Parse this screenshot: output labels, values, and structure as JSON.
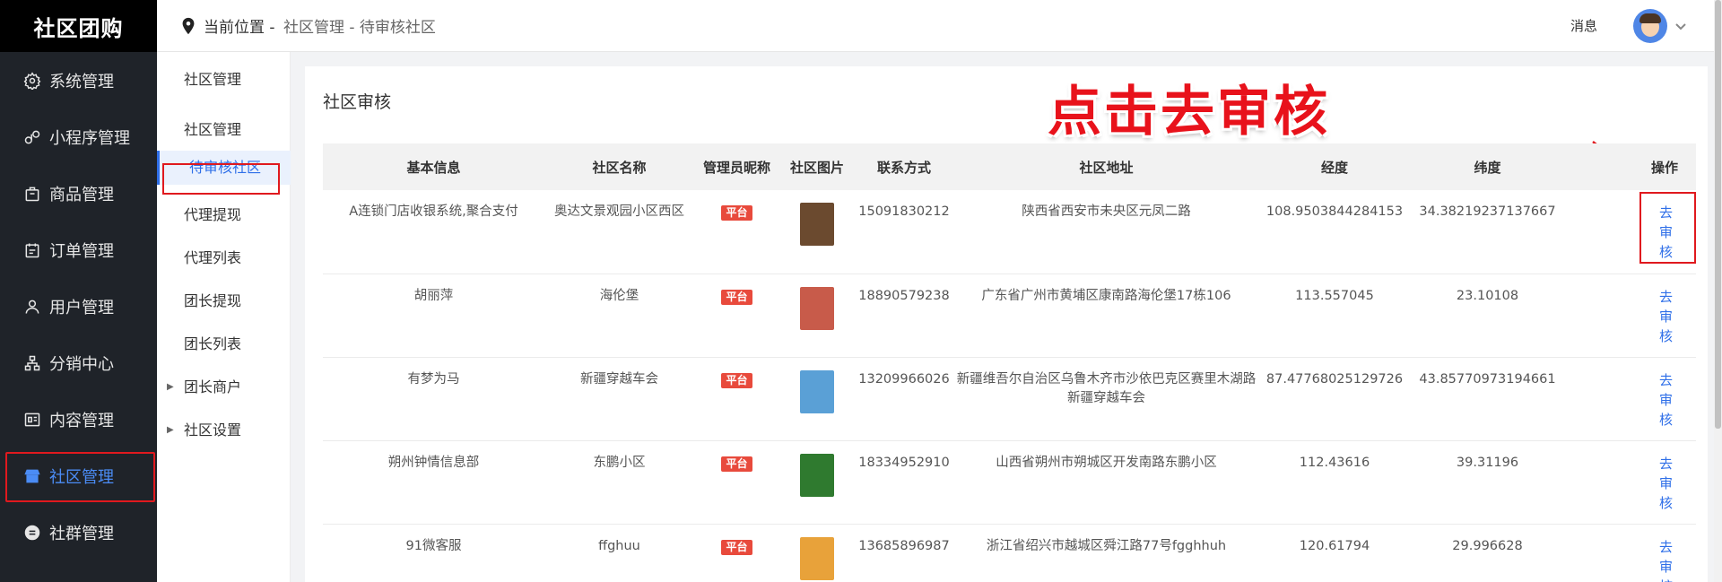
{
  "brand": "社区团购",
  "menu": [
    {
      "label": "系统管理",
      "icon": "gear-icon"
    },
    {
      "label": "小程序管理",
      "icon": "miniprogram-icon"
    },
    {
      "label": "商品管理",
      "icon": "bag-icon"
    },
    {
      "label": "订单管理",
      "icon": "calendar-icon"
    },
    {
      "label": "用户管理",
      "icon": "user-icon"
    },
    {
      "label": "分销中心",
      "icon": "org-icon"
    },
    {
      "label": "内容管理",
      "icon": "content-icon"
    },
    {
      "label": "社区管理",
      "icon": "store-icon"
    },
    {
      "label": "社群管理",
      "icon": "group-icon"
    }
  ],
  "topbar": {
    "crumb_prefix": "当前位置 - ",
    "crumb_rest": "社区管理 - 待审核社区",
    "message": "消息"
  },
  "submenu": {
    "header": "社区管理",
    "items": [
      "社区管理",
      "待审核社区",
      "代理提现",
      "代理列表",
      "团长提现",
      "团长列表",
      "团长商户",
      "社区设置"
    ]
  },
  "content": {
    "title": "社区审核",
    "overlay": "点击去审核"
  },
  "table": {
    "headers": [
      "基本信息",
      "社区名称",
      "管理员昵称",
      "社区图片",
      "联系方式",
      "社区地址",
      "经度",
      "纬度",
      "操作"
    ],
    "rows": [
      {
        "info": "A连锁门店收银系统,聚合支付",
        "name": "奥达文景观园小区西区",
        "admin": "平台",
        "phone": "15091830212",
        "address": "陕西省西安市未央区元凤二路",
        "lng": "108.9503844284153",
        "lat": "34.38219237137667",
        "op": "去审核",
        "img": "#6b4a2f"
      },
      {
        "info": "胡丽萍",
        "name": "海伦堡",
        "admin": "平台",
        "phone": "18890579238",
        "address": "广东省广州市黄埔区康南路海伦堡17栋106",
        "lng": "113.557045",
        "lat": "23.10108",
        "op": "去审核",
        "img": "#c85b4a"
      },
      {
        "info": "有梦为马",
        "name": "新疆穿越车会",
        "admin": "平台",
        "phone": "13209966026",
        "address": "新疆维吾尔自治区乌鲁木齐市沙依巴克区赛里木湖路新疆穿越车会",
        "lng": "87.47768025129726",
        "lat": "43.85770973194661",
        "op": "去审核",
        "img": "#5aa0d6"
      },
      {
        "info": "朔州钟情信息部",
        "name": "东鹏小区",
        "admin": "平台",
        "phone": "18334952910",
        "address": "山西省朔州市朔城区开发南路东鹏小区",
        "lng": "112.43616",
        "lat": "39.31196",
        "op": "去审核",
        "img": "#2f7a2f"
      },
      {
        "info": "91微客服",
        "name": "ffghuu",
        "admin": "平台",
        "phone": "13685896987",
        "address": "浙江省绍兴市越城区舜江路77号fgghhuh",
        "lng": "120.61794",
        "lat": "29.996628",
        "op": "去审核",
        "img": "#e8a23a"
      }
    ]
  },
  "colors": {
    "accent": "#2f6fe8",
    "annotation": "#e0191e",
    "badge": "#e84a3c",
    "sidebar": "#1f2329"
  }
}
